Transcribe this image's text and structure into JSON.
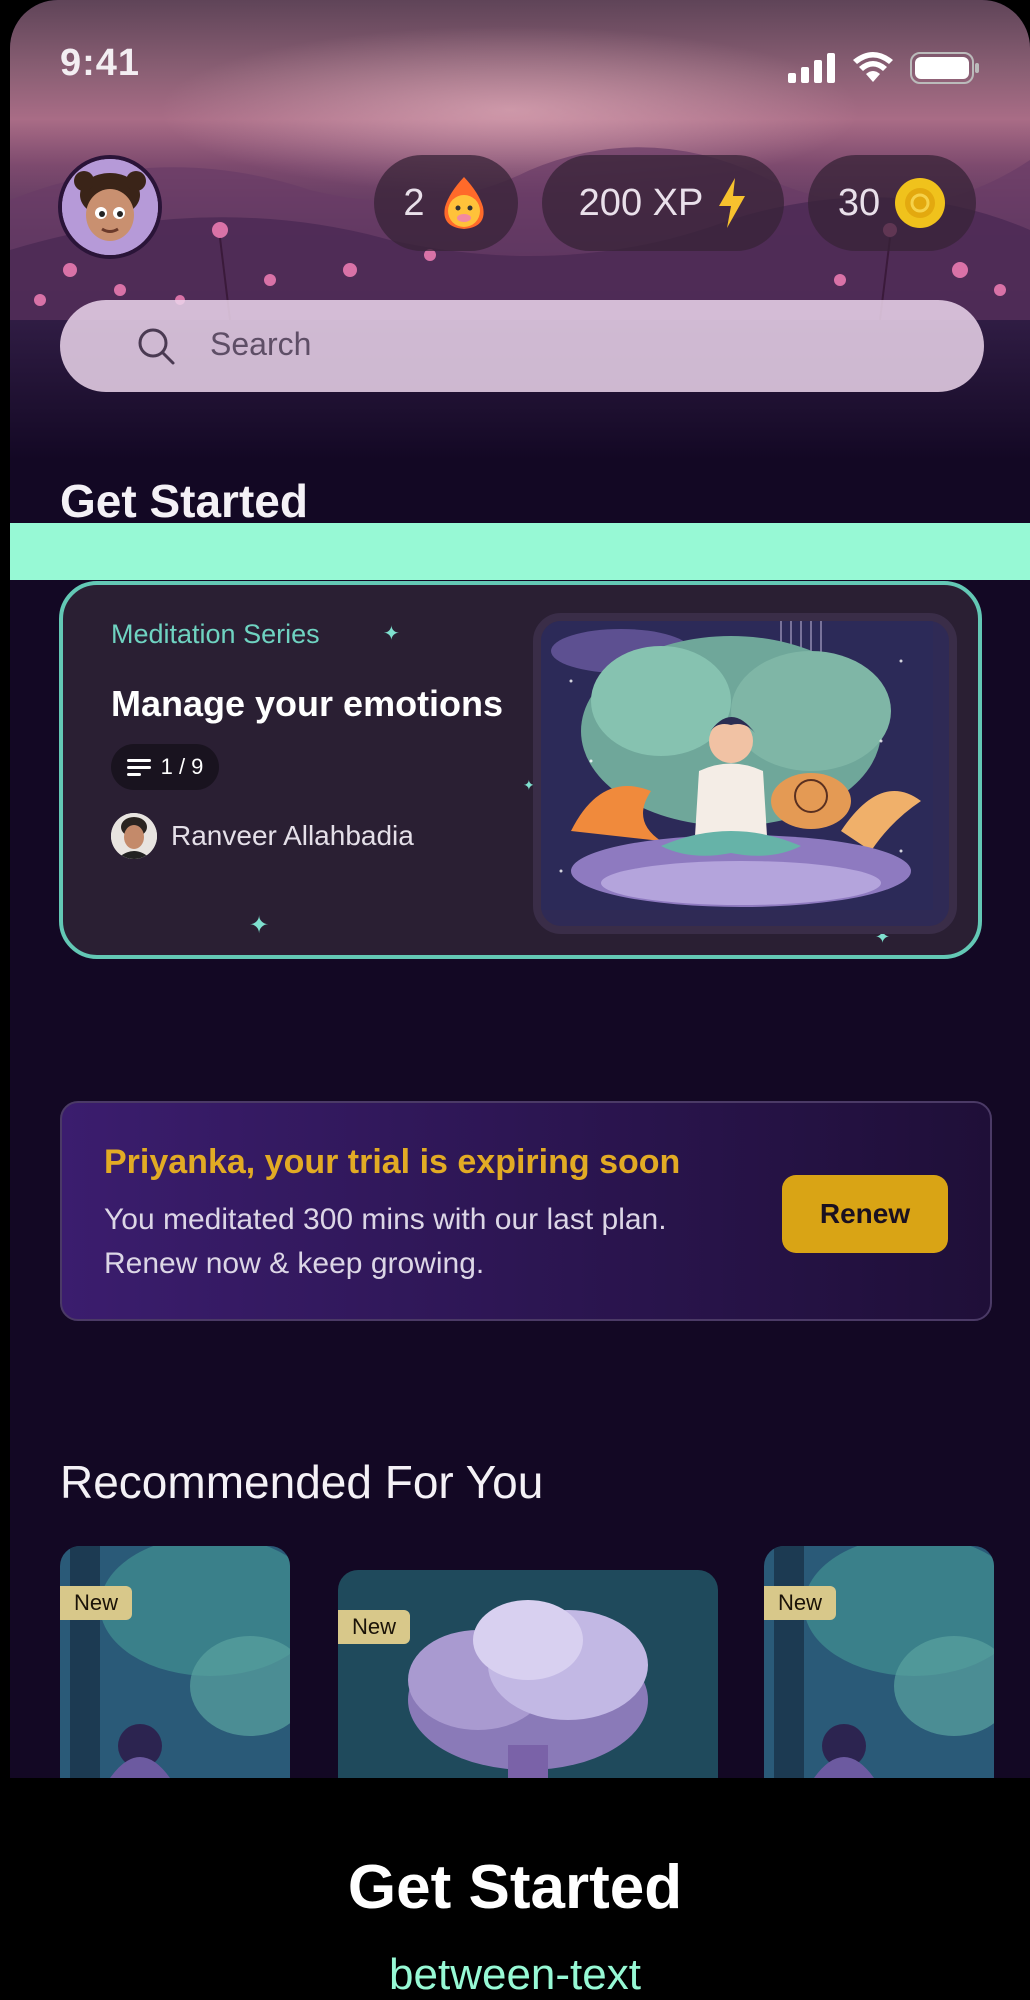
{
  "status": {
    "time": "9:41"
  },
  "header": {
    "streak_count": "2",
    "xp_label": "200 XP",
    "coins_count": "30"
  },
  "search": {
    "placeholder": "Search"
  },
  "get_started": {
    "title": "Get Started",
    "card": {
      "eyebrow": "Meditation Series",
      "title": "Manage your emotions",
      "progress": "1 / 9",
      "author": "Ranveer Allahbadia"
    }
  },
  "trial": {
    "title": "Priyanka, your trial is expiring soon",
    "message": "You meditated 300 mins with our last plan. Renew now & keep growing.",
    "button_label": "Renew"
  },
  "recommended": {
    "title": "Recommended For You",
    "items": [
      {
        "badge": "New"
      },
      {
        "badge": "New"
      },
      {
        "badge": "New"
      }
    ]
  },
  "bottom": {
    "title": "Get Started",
    "subtitle": "between-text"
  },
  "colors": {
    "accent_teal": "#63c8b5",
    "highlight_green": "#97f9d5",
    "trial_gold": "#e2ab24",
    "renew_button": "#d9a415",
    "background": "#130824"
  }
}
